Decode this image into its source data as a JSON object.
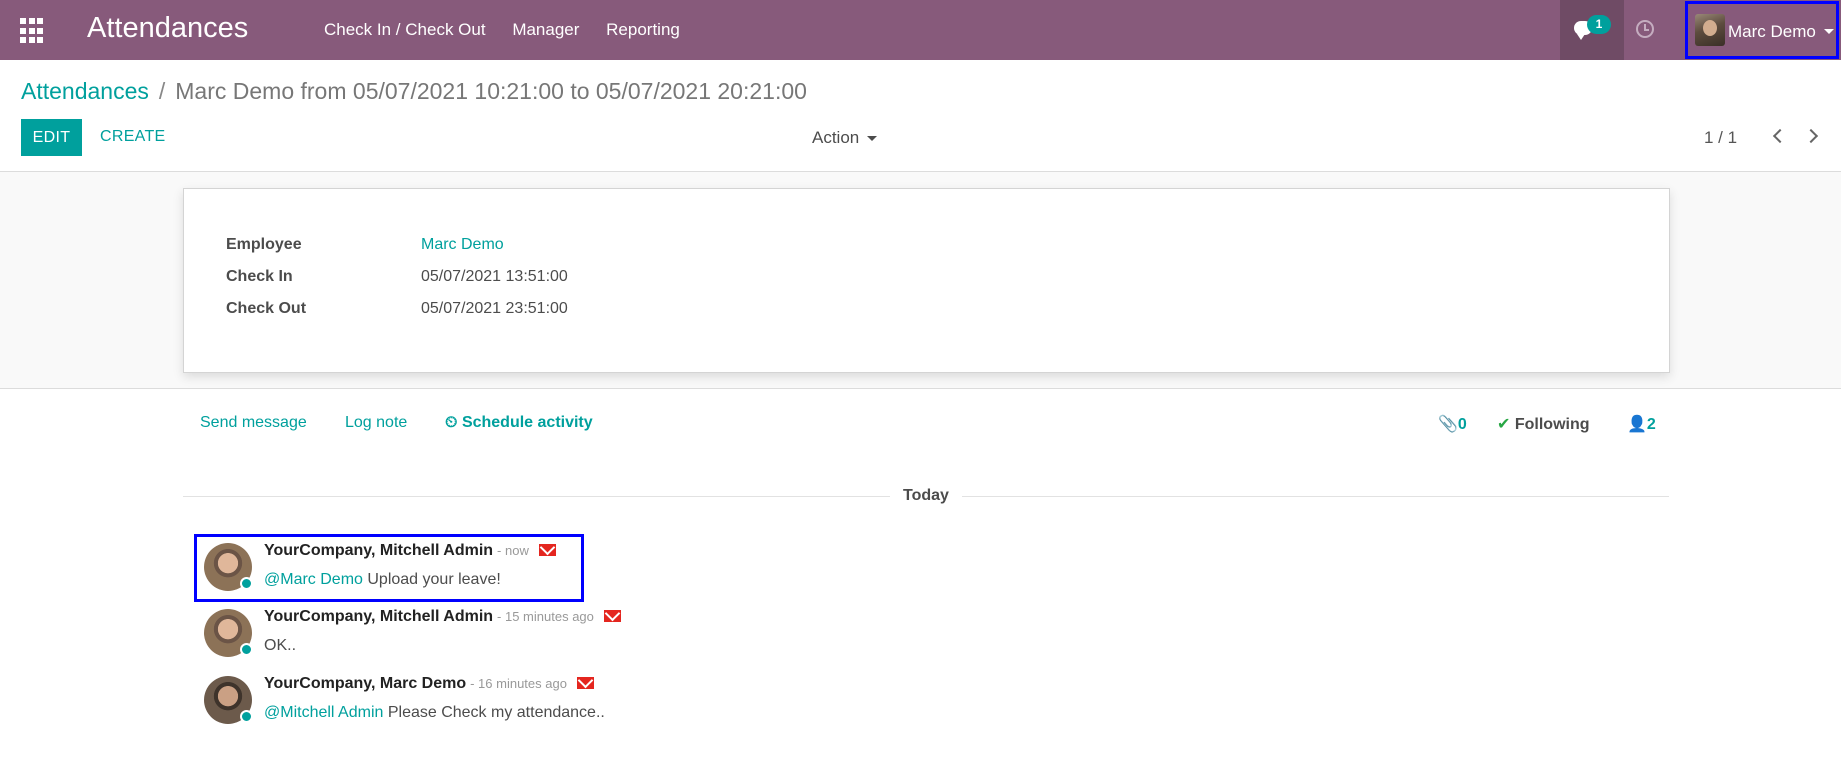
{
  "navbar": {
    "app_title": "Attendances",
    "menu": [
      "Check In / Check Out",
      "Manager",
      "Reporting"
    ],
    "chat_badge": "1",
    "user_name": "Marc Demo",
    "icons": [
      "apps-grid-icon",
      "chat-bubble-icon",
      "clock-icon",
      "avatar"
    ]
  },
  "breadcrumb": {
    "parent": "Attendances",
    "separator": "/",
    "current": "Marc Demo from 05/07/2021 10:21:00 to 05/07/2021 20:21:00"
  },
  "toolbar": {
    "edit_label": "EDIT",
    "create_label": "CREATE",
    "action_label": "Action",
    "pager": "1 / 1"
  },
  "form": {
    "employee_label": "Employee",
    "employee_value": "Marc Demo",
    "checkin_label": "Check In",
    "checkin_value": "05/07/2021 13:51:00",
    "checkout_label": "Check Out",
    "checkout_value": "05/07/2021 23:51:00"
  },
  "chatter": {
    "send_message": "Send message",
    "log_note": "Log note",
    "schedule_activity": "Schedule activity",
    "attachments": "0",
    "following": "Following",
    "followers": "2",
    "today": "Today",
    "messages": [
      {
        "author": "YourCompany, Mitchell Admin",
        "time": "- now",
        "mention": "@Marc Demo",
        "text": " Upload your leave!"
      },
      {
        "author": "YourCompany, Mitchell Admin",
        "time": "- 15 minutes ago",
        "mention": "",
        "text": "OK.."
      },
      {
        "author": "YourCompany, Marc Demo",
        "time": "- 16 minutes ago",
        "mention": "@Mitchell Admin",
        "text": " Please Check my attendance.."
      }
    ]
  },
  "colors": {
    "navbar": "#875a7b",
    "accent": "#00a09d",
    "highlight": "#0000ff",
    "envelope": "#e4261f"
  }
}
